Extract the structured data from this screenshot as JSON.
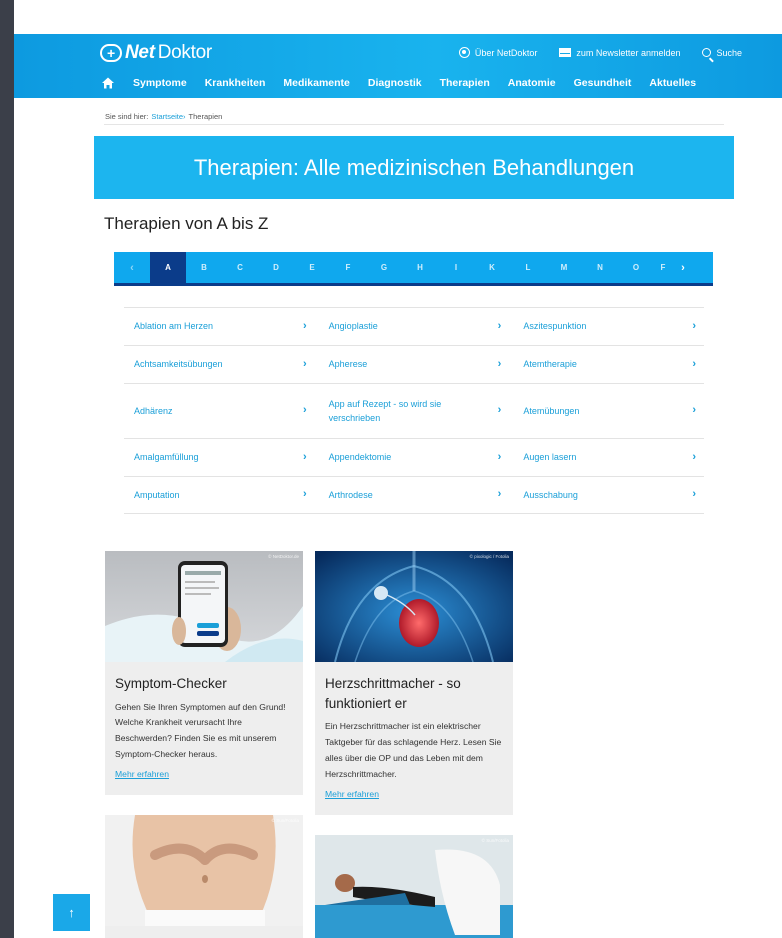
{
  "header": {
    "logo_bold": "Net",
    "logo_rest": "Doktor",
    "links": [
      {
        "label": "Über NetDoktor",
        "icon": "info-icon"
      },
      {
        "label": "zum Newsletter anmelden",
        "icon": "mail-icon"
      },
      {
        "label": "Suche",
        "icon": "search-icon"
      }
    ],
    "nav": [
      "Symptome",
      "Krankheiten",
      "Medikamente",
      "Diagnostik",
      "Therapien",
      "Anatomie",
      "Gesundheit",
      "Aktuelles"
    ]
  },
  "breadcrumb": {
    "prefix": "Sie sind hier:",
    "home": "Startseite",
    "separator": "›",
    "current": "Therapien"
  },
  "hero_title": "Therapien: Alle medizinischen Behandlungen",
  "section_title": "Therapien von A bis Z",
  "alphabet": {
    "letters": [
      "A",
      "B",
      "C",
      "D",
      "E",
      "F",
      "G",
      "H",
      "I",
      "K",
      "L",
      "M",
      "N",
      "O",
      "F"
    ],
    "active": "A",
    "prev": "‹",
    "next": "›"
  },
  "therapies": [
    [
      "Ablation am Herzen",
      "Angioplastie",
      "Aszitespunktion"
    ],
    [
      "Achtsamkeitsübungen",
      "Apherese",
      "Atemtherapie"
    ],
    [
      "Adhärenz",
      "App auf Rezept - so wird sie verschrieben",
      "Atemübungen"
    ],
    [
      "Amalgamfüllung",
      "Appendektomie",
      "Augen lasern"
    ],
    [
      "Amputation",
      "Arthrodese",
      "Ausschabung"
    ]
  ],
  "cards": [
    {
      "title": "Symptom-Checker",
      "text": "Gehen Sie Ihren Symptomen auf den Grund! Welche Krankheit verursacht Ihre Beschwerden? Finden Sie es mit unserem Symptom-Checker heraus.",
      "more": "Mehr erfahren",
      "credit": "© NetDoktor.de"
    },
    {
      "title": "Herzschrittmacher - so funktioniert er",
      "text": "Ein Herzschrittmacher ist ein elektrischer Taktgeber für das schlagende Herz. Lesen Sie alles über die OP und das Leben mit dem Herzschrittmacher.",
      "more": "Mehr erfahren",
      "credit": "© pixologic / Fotolia"
    },
    {
      "credit": "© Sun/Fotolia"
    },
    {
      "credit": "© Sun/Fotolia"
    }
  ],
  "to_top": "↑",
  "colors": {
    "brand": "#1cb5ef",
    "navy": "#0b3c8a",
    "link": "#1a9fd8"
  }
}
